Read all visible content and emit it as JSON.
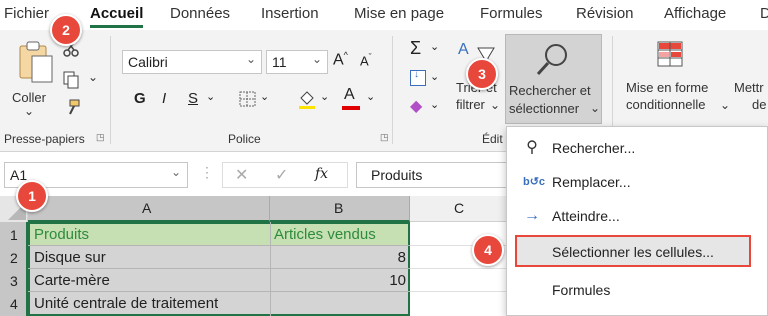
{
  "tabs": [
    "Fichier",
    "Accueil",
    "Données",
    "Insertion",
    "Mise en page",
    "Formules",
    "Révision",
    "Affichage",
    "D"
  ],
  "ribbon": {
    "paste": "Coller",
    "clipboard_group": "Presse-papiers",
    "font_name": "Calibri",
    "font_size": "11",
    "font_group": "Police",
    "bold": "G",
    "italic": "I",
    "underline": "S",
    "sort_filter": "Trier et\nfiltrer",
    "sort_filter_line1": "Trier et",
    "sort_filter_line2": "filtrer",
    "find_select_line1": "Rechercher et",
    "find_select_line2": "sélectionner",
    "cond_format_line1": "Mise en forme",
    "cond_format_line2": "conditionnelle",
    "table_line1": "Mettr",
    "table_line2": "de",
    "editing_group": "Édit"
  },
  "formula_bar": {
    "name_box": "A1",
    "fx": "fx",
    "content": "Produits"
  },
  "grid": {
    "columns": [
      "A",
      "B",
      "C"
    ],
    "rows": [
      {
        "num": "1",
        "a": "Produits",
        "b": "Articles vendus"
      },
      {
        "num": "2",
        "a": "Disque sur",
        "b": "8"
      },
      {
        "num": "3",
        "a": "Carte-mère",
        "b": "10"
      },
      {
        "num": "4",
        "a": "Unité centrale de traitement",
        "b": ""
      }
    ]
  },
  "menu": {
    "items": [
      {
        "label": "Rechercher...",
        "icon": "search-icon"
      },
      {
        "label": "Remplacer...",
        "icon": "replace-icon"
      },
      {
        "label": "Atteindre...",
        "icon": "arrow-right-icon"
      },
      {
        "label": "Sélectionner les cellules...",
        "icon": ""
      },
      {
        "label": "Formules",
        "icon": ""
      }
    ]
  },
  "badges": [
    "1",
    "2",
    "3",
    "4"
  ],
  "colors": {
    "accent": "#217346",
    "badge": "#e8483b",
    "highlight": "#e8483b",
    "selection": "#c6e0b4"
  }
}
